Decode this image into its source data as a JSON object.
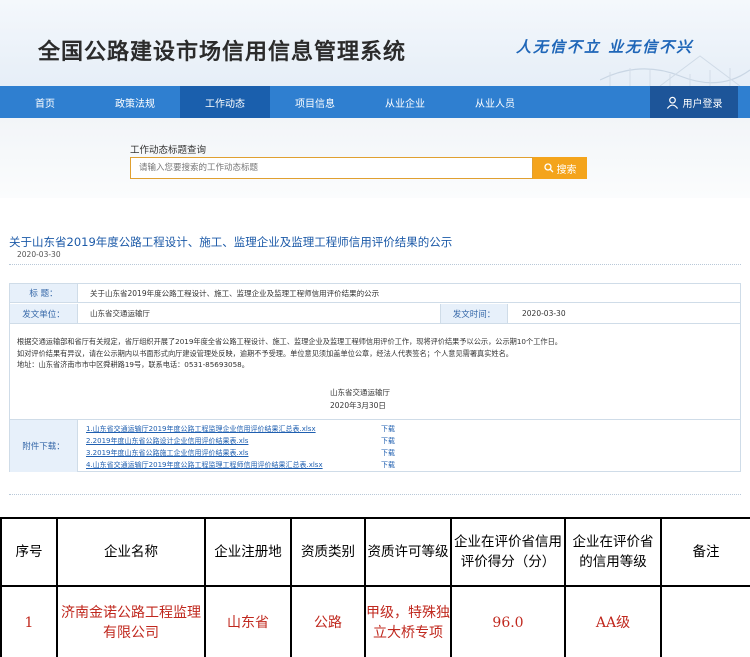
{
  "header": {
    "title": "全国公路建设市场信用信息管理系统",
    "slogan": "人无信不立 业无信不兴"
  },
  "nav": {
    "items": [
      "首页",
      "政策法规",
      "工作动态",
      "项目信息",
      "从业企业",
      "从业人员"
    ],
    "active": "工作动态",
    "login": "用户登录"
  },
  "search": {
    "label": "工作动态标题查询",
    "placeholder": "请输入您要搜索的工作动态标题",
    "button": "搜索"
  },
  "article": {
    "title": "关于山东省2019年度公路工程设计、施工、监理企业及监理工程师信用评价结果的公示",
    "date": "2020-03-30"
  },
  "detail": {
    "title_label": "标    题：",
    "title_value": "关于山东省2019年度公路工程设计、施工、监理企业及监理工程师信用评价结果的公示",
    "unit_label": "发文单位：",
    "unit_value": "山东省交通运输厅",
    "time_label": "发文时间：",
    "time_value": "2020-03-30",
    "body_lines": [
      "根据交通运输部和省厅有关规定，省厅组织开展了2019年度全省公路工程设计、施工、监理企业及监理工程师信用评价工作，现将评价结果予以公示，公示期10个工作日。",
      "如对评价结果有异议，请在公示期内以书面形式向厅建设管理处反映，逾期不予受理。单位意见须加盖单位公章，经法人代表签名；个人意见需署真实姓名。",
      "地址：山东省济南市市中区舜耕路19号，联系电话：0531-85693058。"
    ],
    "sign_unit": "山东省交通运输厅",
    "sign_date": "2020年3月30日",
    "attachment_label": "附件下载：",
    "download_label": "下载",
    "attachments": [
      "1.山东省交通运输厅2019年度公路工程监理企业信用评价结果汇总表.xlsx",
      "2.2019年度山东省公路设计企业信用评价结果表.xls",
      "3.2019年度山东省公路施工企业信用评价结果表.xls",
      "4.山东省交通运输厅2019年度公路工程监理工程师信用评价结果汇总表.xlsx"
    ]
  },
  "result_table": {
    "headers": [
      "序号",
      "企业名称",
      "企业注册地",
      "资质类别",
      "资质许可等级",
      "企业在评价省信用评价得分（分）",
      "企业在评价省的信用等级",
      "备注"
    ],
    "rows": [
      {
        "no": "1",
        "name": "济南金诺公路工程监理有限公司",
        "region": "山东省",
        "category": "公路",
        "grade": "甲级，特殊独立大桥专项",
        "score": "96.0",
        "level": "AA级",
        "note": ""
      }
    ]
  }
}
